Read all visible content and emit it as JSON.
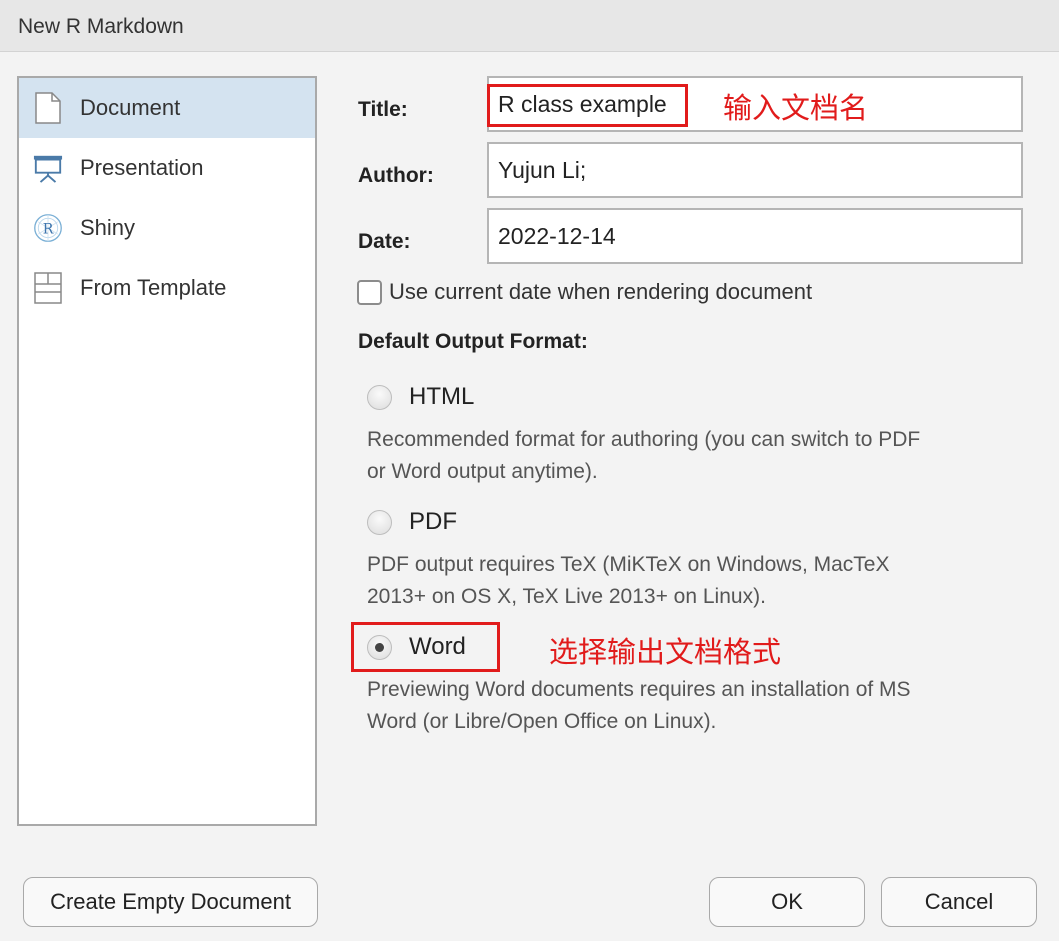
{
  "window": {
    "title": "New R Markdown"
  },
  "sidebar": {
    "items": [
      {
        "label": "Document",
        "icon": "document-icon"
      },
      {
        "label": "Presentation",
        "icon": "presentation-icon"
      },
      {
        "label": "Shiny",
        "icon": "shiny-r-icon"
      },
      {
        "label": "From Template",
        "icon": "template-icon"
      }
    ],
    "selected_index": 0
  },
  "form": {
    "title_label": "Title:",
    "title_value": "R class example",
    "author_label": "Author:",
    "author_value": "Yujun Li;",
    "date_label": "Date:",
    "date_value": "2022-12-14",
    "use_current_date_label": "Use current date when rendering document",
    "use_current_date_checked": false
  },
  "output": {
    "section_title": "Default Output Format:",
    "options": [
      {
        "label": "HTML",
        "description": [
          "Recommended format for authoring (you can switch to PDF",
          "or Word output anytime)."
        ],
        "selected": false
      },
      {
        "label": "PDF",
        "description": [
          "PDF output requires TeX (MiKTeX on Windows, MacTeX",
          "2013+ on OS X, TeX Live 2013+ on Linux)."
        ],
        "selected": false
      },
      {
        "label": "Word",
        "description": [
          "Previewing Word documents requires an installation of MS",
          "Word (or Libre/Open Office on Linux)."
        ],
        "selected": true
      }
    ]
  },
  "annotations": {
    "title_note": "输入文档名",
    "format_note": "选择输出文档格式",
    "color": "#e11b1b"
  },
  "buttons": {
    "create_empty": "Create Empty Document",
    "ok": "OK",
    "cancel": "Cancel"
  },
  "colors": {
    "selected_bg": "#d4e3f0",
    "icon_blue": "#4a7aa8"
  }
}
